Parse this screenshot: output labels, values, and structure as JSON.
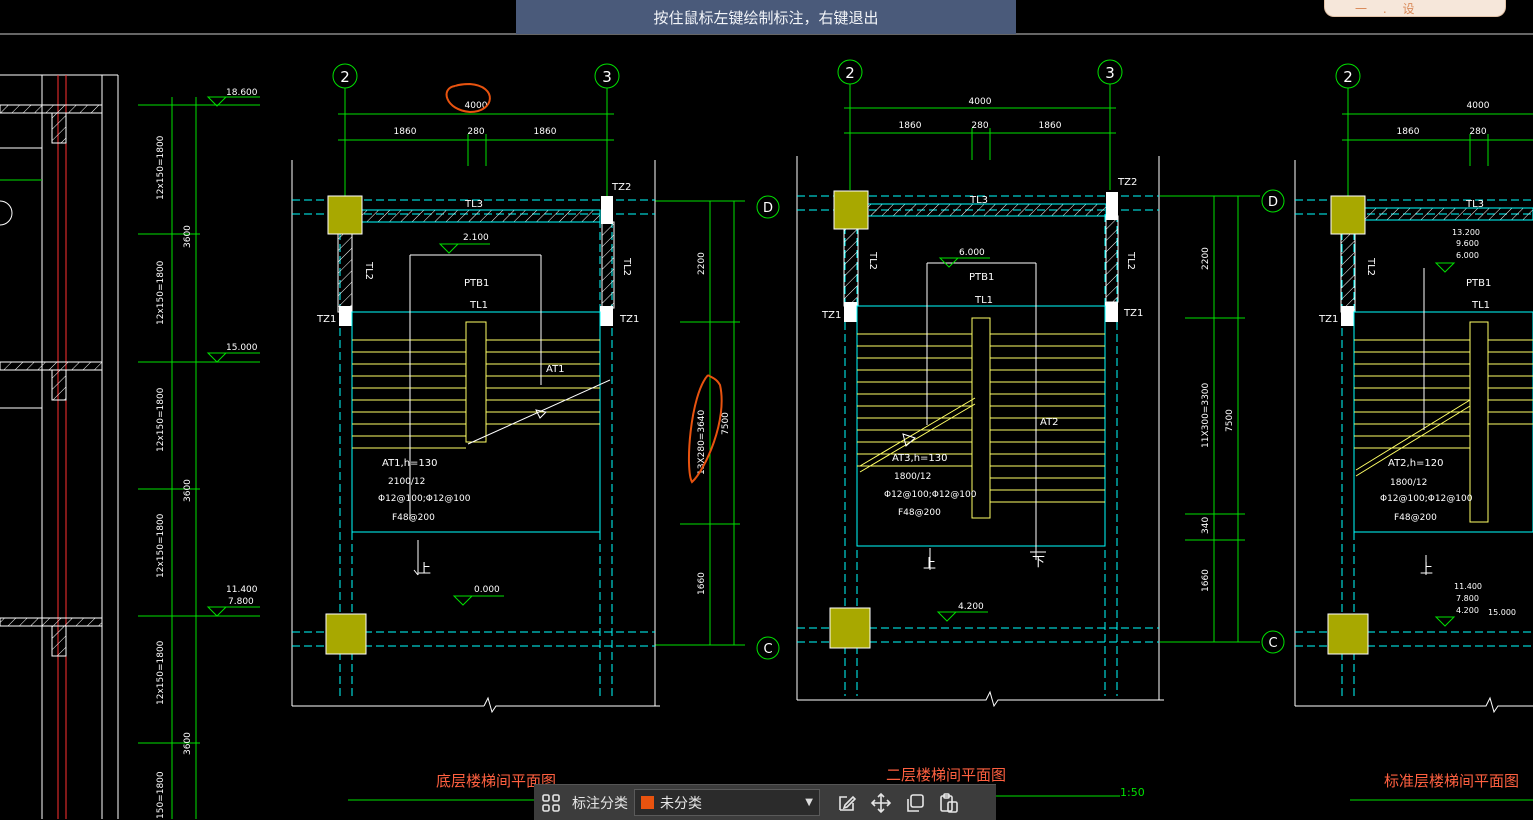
{
  "hint": {
    "text": "按住鼠标左键绘制标注，右键退出"
  },
  "badge": {
    "text": "一 . 设 "
  },
  "toolbar": {
    "category_label": "标注分类",
    "selected_category": "未分类",
    "selected_color": "#e8530f",
    "icons": [
      "grid-icon",
      "edit-icon",
      "move-icon",
      "copy-icon",
      "paste-icon"
    ]
  },
  "drawing": {
    "colors": {
      "green": "#00e000",
      "cyan": "#00ffff",
      "yellow": "#ffff66",
      "white": "#ffffff",
      "olive": "#a8a800",
      "red": "#ff3030",
      "orange": "#e8530f",
      "title": "#ff6040"
    },
    "elevations_left": [
      "18.600",
      "15.000",
      "11.400",
      "7.800"
    ],
    "vert_dims_left": [
      "12x150=1800",
      "3600",
      "12x150=1800",
      "12x150=1800",
      "3600",
      "12x150=1800",
      "12x150=1800",
      "3600",
      "150=1800"
    ],
    "plans": [
      {
        "axes": [
          "2",
          "3"
        ],
        "top_dim": "4000",
        "sub_dims": [
          "1860",
          "280",
          "1860"
        ],
        "beams": {
          "top": "TL3",
          "mid": "TL1",
          "col_top": "TZ2",
          "col_left": "TZ1",
          "col_right": "TZ1",
          "side": "TL2"
        },
        "platform": "PTB1",
        "platform_elev": "2.100",
        "flight": "AT1",
        "notes": [
          "AT1,h=130",
          "2100/12",
          "Φ12@100;Φ12@100",
          "F48@200"
        ],
        "up_label": "上",
        "floor_elev": "0.000",
        "title": "底层楼梯间平面图"
      },
      {
        "axes": [
          "2",
          "3"
        ],
        "top_dim": "4000",
        "sub_dims": [
          "1860",
          "280",
          "1860"
        ],
        "beams": {
          "top": "TL3",
          "mid": "TL1",
          "col_top": "TZ2",
          "col_left": "TZ1",
          "col_right": "TZ1",
          "side": "TL2"
        },
        "platform": "PTB1",
        "platform_elev": "6.000",
        "flight": "AT2",
        "notes": [
          "AT3,h=130",
          "1800/12",
          "Φ12@100;Φ12@100",
          "F48@200"
        ],
        "up_label": "上",
        "down_label": "下",
        "floor_elev": "4.200",
        "title": "二层楼梯间平面图"
      },
      {
        "axes": [
          "2"
        ],
        "top_dim": "4000",
        "sub_dims": [
          "1860",
          "280"
        ],
        "beams": {
          "top": "TL3",
          "mid": "TL1",
          "col_left": "TZ1",
          "side": "TL2"
        },
        "platform": "PTB1",
        "platform_elevs": [
          "13.200",
          "9.600",
          "6.000"
        ],
        "notes": [
          "AT2,h=120",
          "1800/12",
          "Φ12@100;Φ12@100",
          "F48@200"
        ],
        "up_label": "上",
        "floor_elevs": [
          "11.400",
          "7.800",
          "4.200",
          "15.000"
        ],
        "title": "标准层楼梯间平面图"
      }
    ],
    "between_dims_1": {
      "axes": [
        "D",
        "C"
      ],
      "dims": [
        "2200",
        "13X280=3640",
        "1660"
      ],
      "total": "7500"
    },
    "between_dims_2": {
      "axes": [
        "D",
        "C"
      ],
      "dims": [
        "2200",
        "11X300=3300",
        "340",
        "1660"
      ],
      "total": "7500"
    },
    "scale": "1:50"
  }
}
